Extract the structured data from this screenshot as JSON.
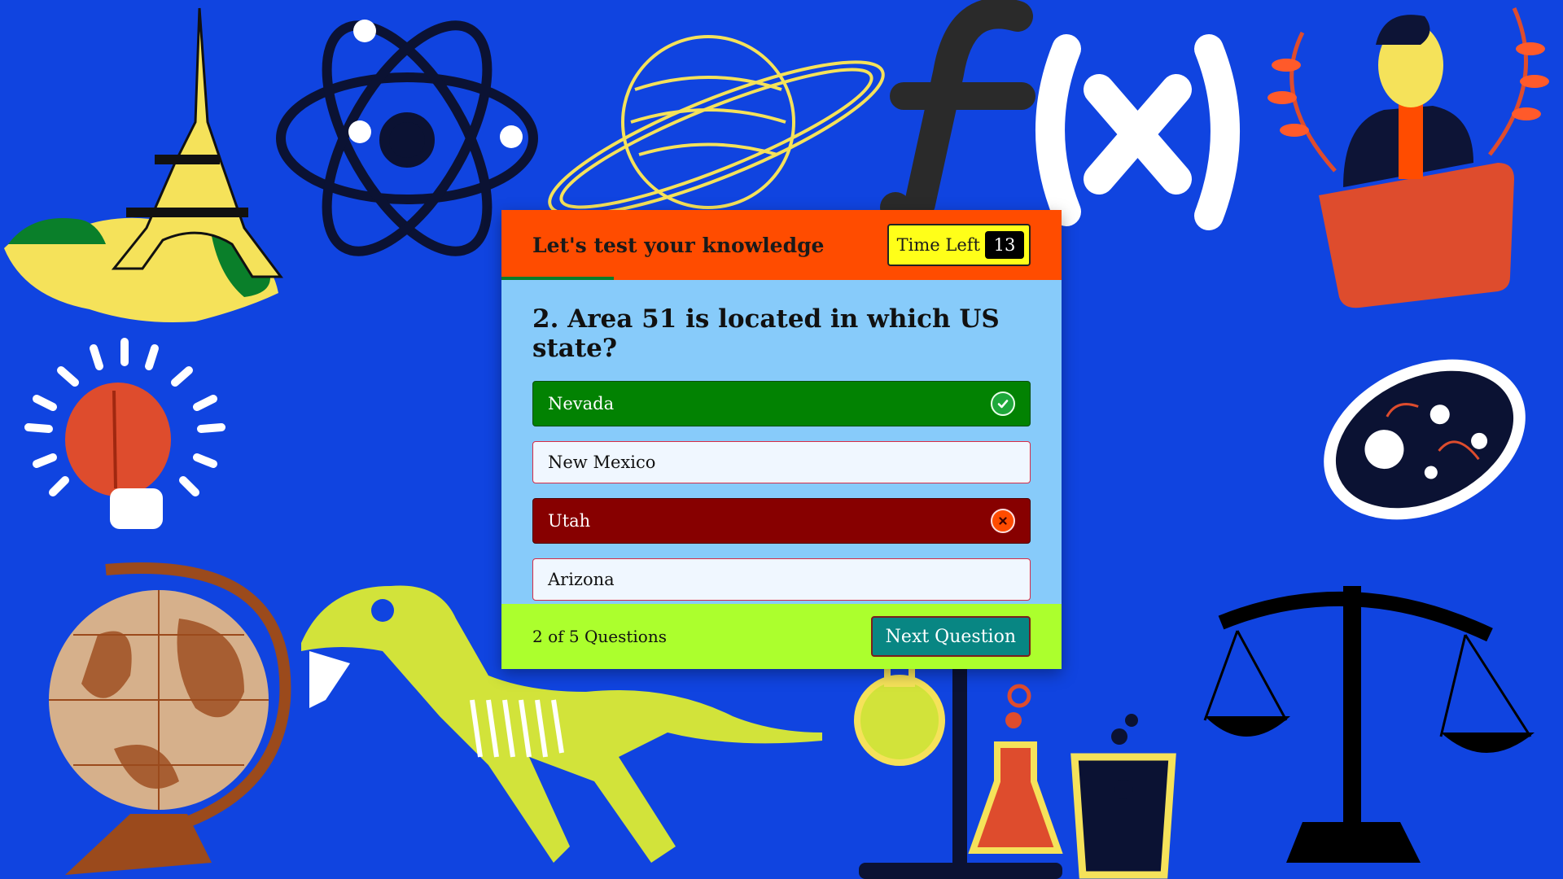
{
  "quiz": {
    "title": "Let's test your knowledge",
    "timer_label": "Time Left",
    "timer_value": "13",
    "question": "2. Area 51 is located in which US state?",
    "options": [
      {
        "label": "Nevada",
        "state": "correct"
      },
      {
        "label": "New Mexico",
        "state": "default"
      },
      {
        "label": "Utah",
        "state": "wrong"
      },
      {
        "label": "Arizona",
        "state": "default"
      }
    ],
    "timer_progress": 0.2,
    "question_counter": "2 of 5 Questions",
    "next_button": "Next Question"
  },
  "colors": {
    "background": "#1044e0",
    "header": "#ff4c00",
    "body": "#87cbfa",
    "footer": "#acff2d",
    "correct": "#028202",
    "wrong": "#870000",
    "button": "#088683"
  },
  "decorations": [
    "eiffel-tower-icon",
    "atom-icon",
    "saturn-icon",
    "function-fx-icon",
    "person-trophy-icon",
    "lightbulb-brain-icon",
    "bacterium-icon",
    "globe-icon",
    "dinosaur-skeleton-icon",
    "lab-glassware-icon",
    "scales-icon"
  ]
}
